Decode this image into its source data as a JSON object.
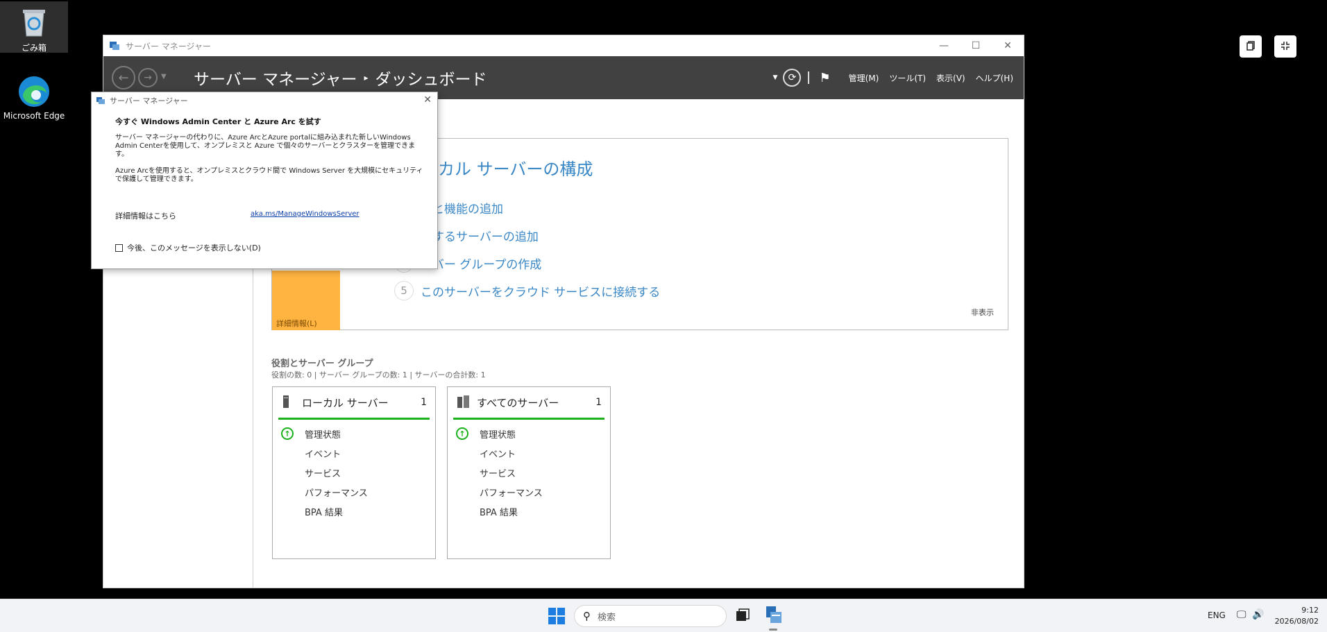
{
  "desktop": {
    "icons": [
      {
        "label": "ごみ箱",
        "icon": "recycle-bin-icon"
      },
      {
        "label": "Microsoft Edge",
        "icon": "edge-icon"
      }
    ]
  },
  "remote_controls": [
    "copy-icon",
    "exit-fullscreen-icon"
  ],
  "window": {
    "title": "サーバー マネージャー",
    "breadcrumb_root": "サーバー マネージャー",
    "breadcrumb_sep": "▸",
    "breadcrumb_current": "ダッシュボード",
    "menu": [
      "管理(M)",
      "ツール(T)",
      "表示(V)",
      "ヘルプ(H)"
    ]
  },
  "quick_start": {
    "heading": "ーカル サーバーの構成",
    "items": [
      {
        "num": "",
        "label": "割と機能の追加"
      },
      {
        "num": "",
        "label": "理するサーバーの追加"
      },
      {
        "num": "",
        "label": "ーバー グループの作成"
      },
      {
        "num": "5",
        "label": "このサーバーをクラウド サービスに接続する"
      }
    ],
    "more_info": "詳細情報(L)",
    "hide": "非表示"
  },
  "roles": {
    "title": "役割とサーバー グループ",
    "summary": "役割の数: 0 | サーバー グループの数: 1 | サーバーの合計数: 1",
    "tiles": [
      {
        "name": "ローカル サーバー",
        "count": "1",
        "rows": [
          "管理状態",
          "イベント",
          "サービス",
          "パフォーマンス",
          "BPA 結果"
        ]
      },
      {
        "name": "すべてのサーバー",
        "count": "1",
        "rows": [
          "管理状態",
          "イベント",
          "サービス",
          "パフォーマンス",
          "BPA 結果"
        ]
      }
    ]
  },
  "dialog": {
    "title": "サーバー マネージャー",
    "heading": "今すぐ Windows Admin Center と Azure Arc を試す",
    "para1": "サーバー マネージャーの代わりに、Azure ArcとAzure portalに組み込まれた新しいWindows Admin Centerを使用して、オンプレミスと Azure で個々のサーバーとクラスターを管理できます。",
    "para2": "Azure Arcを使用すると、オンプレミスとクラウド間で Windows Server を大規模にセキュリティで保護して管理できます。",
    "details_label": "詳細情報はこちら",
    "link": "aka.ms/ManageWindowsServer",
    "checkbox": "今後、このメッセージを表示しない(D)"
  },
  "taskbar": {
    "search_placeholder": "検索",
    "lang": "ENG",
    "time": "9:12",
    "date": "2026/08/02"
  },
  "colors": {
    "accent": "#3a87c6",
    "status_ok": "#1ab11a",
    "orange": "#ffb340",
    "toolbar": "#414141"
  }
}
